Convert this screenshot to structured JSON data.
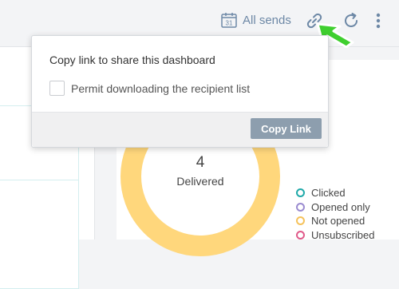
{
  "toolbar": {
    "all_sends_label": "All sends",
    "calendar_day": "31"
  },
  "share_popover": {
    "title": "Copy link to share this dashboard",
    "permit_label": "Permit downloading the recipient list",
    "permit_checked": false,
    "copy_button_label": "Copy Link"
  },
  "summary": {
    "delivered_count": "4",
    "delivered_label": "Delivered"
  },
  "legend": [
    {
      "label": "Clicked",
      "color": "#1fa9a9"
    },
    {
      "label": "Opened only",
      "color": "#9a8bd0"
    },
    {
      "label": "Not opened",
      "color": "#f5c25b"
    },
    {
      "label": "Unsubscribed",
      "color": "#e05a8a"
    }
  ],
  "colors": {
    "accent": "#6d88a6",
    "donut": "#ffd77c",
    "pointer": "#3fcf2f",
    "button": "#8d9eae"
  }
}
